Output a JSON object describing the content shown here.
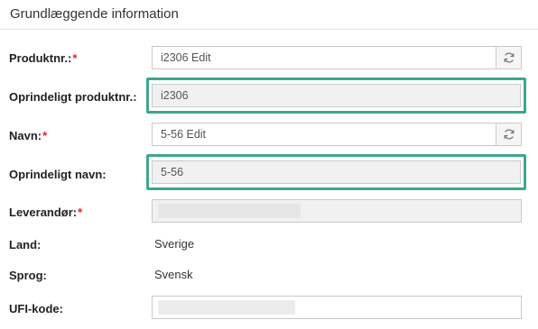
{
  "section": {
    "title": "Grundlæggende information"
  },
  "fields": {
    "produktnr": {
      "label": "Produktnr.:",
      "required_mark": "*",
      "value": "i2306 Edit",
      "button_icon": "refresh-icon"
    },
    "oprindeligt_produktnr": {
      "label": "Oprindeligt produktnr.:",
      "value": "i2306"
    },
    "navn": {
      "label": "Navn:",
      "required_mark": "*",
      "value": "5-56 Edit",
      "button_icon": "refresh-icon"
    },
    "oprindeligt_navn": {
      "label": "Oprindeligt navn:",
      "value": "5-56"
    },
    "leverandor": {
      "label": "Leverandør:",
      "required_mark": "*"
    },
    "land": {
      "label": "Land:",
      "value": "Sverige"
    },
    "sprog": {
      "label": "Sprog:",
      "value": "Svensk"
    },
    "ufi_kode": {
      "label": "UFI-kode:"
    }
  },
  "colors": {
    "highlight": "#3fa68e",
    "required": "#e0242b"
  }
}
